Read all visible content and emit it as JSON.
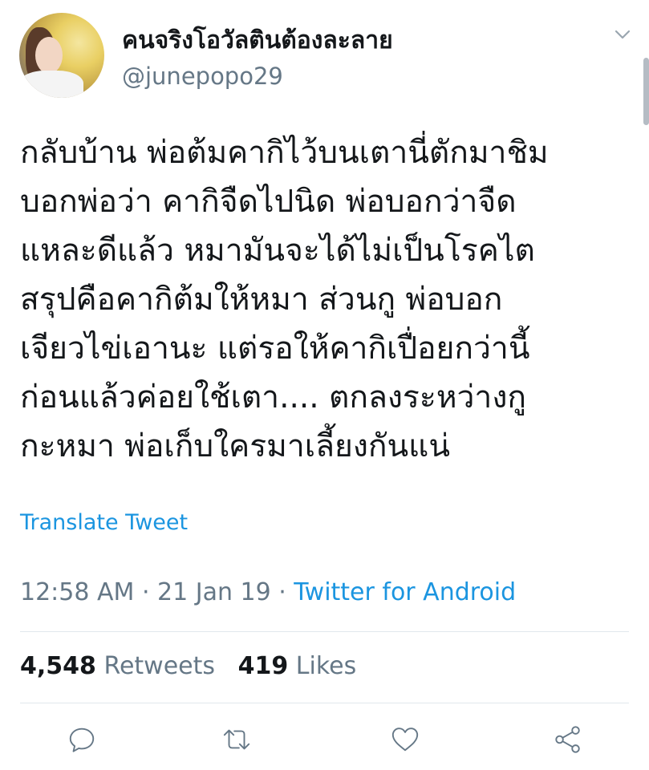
{
  "user": {
    "display_name": "คนจริงโอวัลตินต้องละลาย",
    "handle": "@junepopo29"
  },
  "tweet": {
    "lines": [
      "กลับบ้าน พ่อต้มคากิไว้บนเตานี่ตักมาชิม",
      "บอกพ่อว่า คากิจืดไปนิด พ่อบอกว่าจืด",
      "แหละดีแล้ว หมามันจะได้ไม่เป็นโรคไต",
      "สรุปคือคากิต้มให้หมา ส่วนกู พ่อบอก",
      "เจียวไข่เอานะ แต่รอให้คากิเปื่อยกว่านี้",
      "ก่อนแล้วค่อยใช้เตา.... ตกลงระหว่างกู",
      "กะหมา พ่อเก็บใครมาเลี้ยงกันแน่"
    ],
    "translate_label": "Translate Tweet",
    "time": "12:58 AM",
    "date": "21 Jan 19",
    "separator": " · ",
    "source": "Twitter for Android"
  },
  "stats": {
    "retweets_count": "4,548",
    "retweets_label": "Retweets",
    "likes_count": "419",
    "likes_label": "Likes"
  },
  "icons": {
    "caret": "chevron-down-icon",
    "reply": "reply-icon",
    "retweet": "retweet-icon",
    "like": "heart-icon",
    "share": "share-icon"
  },
  "colors": {
    "accent": "#1b95e0",
    "secondary_text": "#657786",
    "primary_text": "#14171a",
    "divider": "#e1e8ed"
  }
}
